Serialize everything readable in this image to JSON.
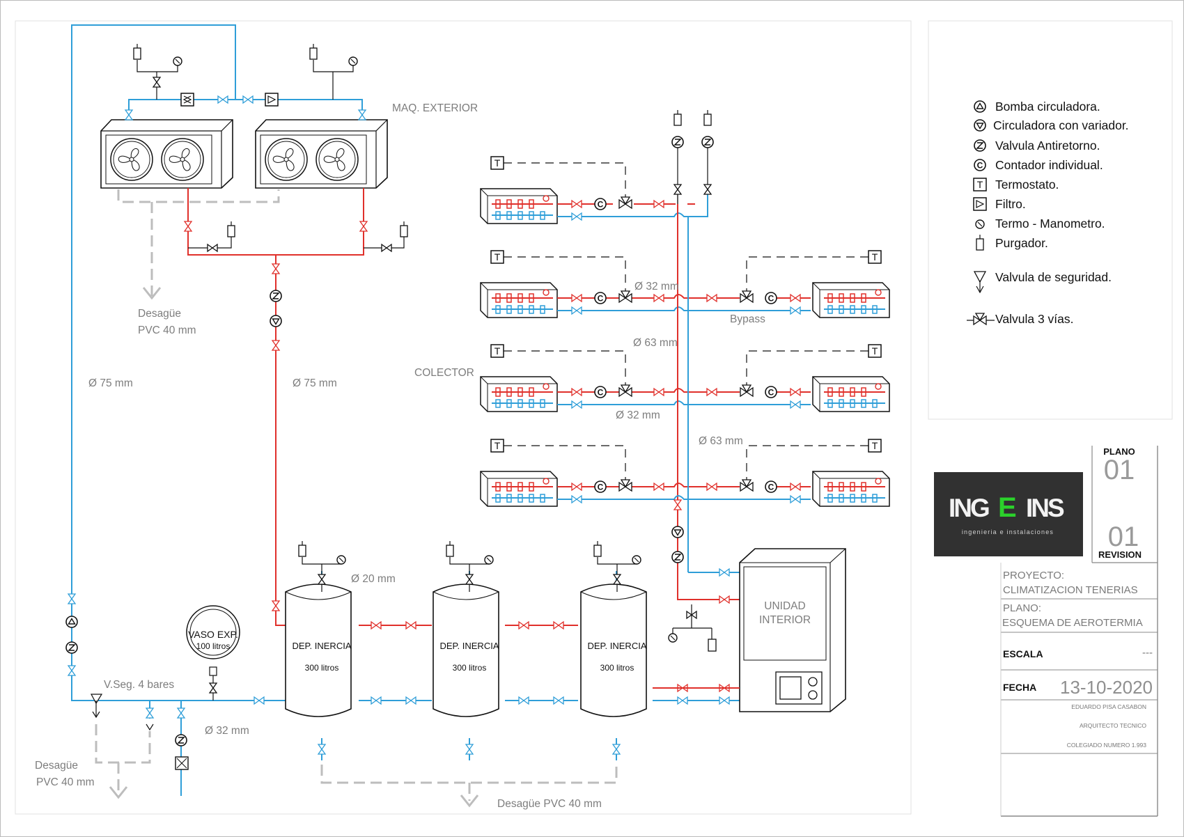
{
  "legend": {
    "items": [
      {
        "icon": "pump-icon",
        "label": "Bomba circuladora."
      },
      {
        "icon": "variable-pump-icon",
        "label": "Circuladora con variador."
      },
      {
        "icon": "check-valve-icon",
        "label": "Valvula Antiretorno."
      },
      {
        "icon": "meter-icon",
        "label": "Contador individual."
      },
      {
        "icon": "thermostat-icon",
        "label": "Termostato."
      },
      {
        "icon": "filter-icon",
        "label": "Filtro."
      },
      {
        "icon": "thermo-manometer-icon",
        "label": "Termo - Manometro."
      },
      {
        "icon": "air-vent-icon",
        "label": "Purgador."
      },
      {
        "icon": "safety-valve-icon",
        "label": "Valvula de seguridad."
      },
      {
        "icon": "three-way-valve-icon",
        "label": "Valvula 3 vías."
      }
    ]
  },
  "labels": {
    "outdoor_unit": "MAQ. EXTERIOR",
    "drain_top_1": "Desagüe",
    "drain_top_2": "PVC 40 mm",
    "pipe_75_left": "Ø 75 mm",
    "pipe_75_mid": "Ø 75 mm",
    "collector": "COLECTOR",
    "pipe_32_a": "Ø 32 mm",
    "pipe_63_a": "Ø 63 mm",
    "pipe_32_b": "Ø 32 mm",
    "pipe_63_b": "Ø 63 mm",
    "bypass": "Bypass",
    "pipe_20": "Ø 20 mm",
    "pipe_32_bottom": "Ø 32 mm",
    "expansion_vessel_1": "VASO EXP.",
    "expansion_vessel_2": "100 litros",
    "safety_valve": "V.Seg. 4 bares",
    "drain_bottom_1": "Desagüe",
    "drain_bottom_2": "PVC 40 mm",
    "drain_bottom_center": "Desagüe PVC 40 mm",
    "tank_name": "DEP. INERCIA",
    "tank_capacity": "300 litros",
    "indoor_unit_1": "UNIDAD",
    "indoor_unit_2": "INTERIOR"
  },
  "title_block": {
    "plano_label": "PLANO",
    "plano_number": "01",
    "revision_number": "01",
    "revision_label": "REVISION",
    "logo_text_a": "ING",
    "logo_text_e": "E",
    "logo_text_b": "INS",
    "logo_tagline": "ingenieria e instalaciones",
    "proyecto_label": "PROYECTO:",
    "proyecto_value": "CLIMATIZACION TENERIAS",
    "plano_desc_label": "PLANO:",
    "plano_desc_value": "ESQUEMA DE AEROTERMIA",
    "escala_label": "ESCALA",
    "escala_value": "---",
    "fecha_label": "FECHA",
    "fecha_value": "13-10-2020",
    "author": "EDUARDO PISA CASABON",
    "profession": "ARQUITECTO TECNICO",
    "registration": "COLEGIADO NUMERO 1.993"
  },
  "colors": {
    "hot_pipe": "#e0302b",
    "cold_pipe": "#2f9ed8",
    "drain": "#bdbdbd",
    "ink": "#111111",
    "logo_green": "#2bd12b",
    "logo_bg": "#3a3a3a"
  }
}
